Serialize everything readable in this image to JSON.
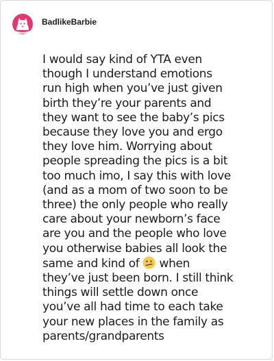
{
  "post": {
    "username": "BadlikeBarbie",
    "avatar_icon": "cartoon-cat-avatar-icon",
    "comment_lines": [
      "I would say kind of YTA even",
      "though I understand emotions",
      "run high when you’ve just given",
      "birth they’re your parents and",
      "they want to see the baby’s pics",
      "because they love you and ergo",
      "they love him. Worrying about",
      "people spreading the pics is a bit",
      "too much imo, I say this with love",
      "(and as a mom of two soon to be",
      "three) the only people who really",
      "care about your newborn’s face",
      "are you and the people who love",
      "you otherwise babies all look the",
      "same and kind of",
      "when",
      "they’ve just been born. I still think",
      "things will settle down once",
      "you’ve all had time to each take",
      "your new places in the family as",
      "parents/grandparents"
    ],
    "emoji_icon": "confused-face-emoji-icon"
  },
  "colors": {
    "avatar_bg": "#e8356f",
    "text": "#1b1b1b",
    "border": "#d7d7d7",
    "emoji_face": "#f7c948"
  }
}
